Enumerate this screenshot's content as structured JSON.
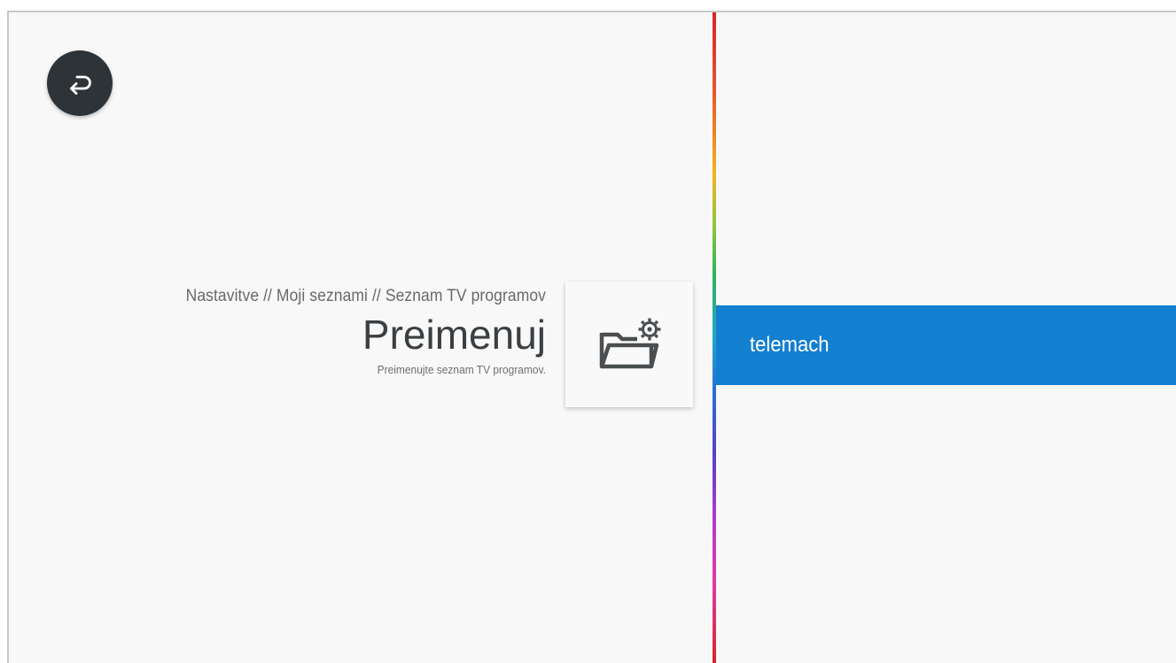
{
  "header": {
    "back_icon": "return-arrow-icon"
  },
  "settings": {
    "breadcrumb": "Nastavitve // Moji seznami // Seznam TV programov",
    "title": "Preimenuj",
    "subtitle": "Preimenujte seznam TV programov.",
    "icon": "folder-gear-icon"
  },
  "channel_lists": {
    "items": [
      {
        "label": "telemach",
        "selected": true
      }
    ]
  },
  "colors": {
    "background": "#f8f8f8",
    "selection": "#137fd1",
    "back_button": "#2e3337",
    "divider": [
      "#d6232a",
      "#f2b51c",
      "#2fb45a",
      "#1ea9c8",
      "#2a6fd6",
      "#b03cc8",
      "#e23aa0"
    ]
  }
}
